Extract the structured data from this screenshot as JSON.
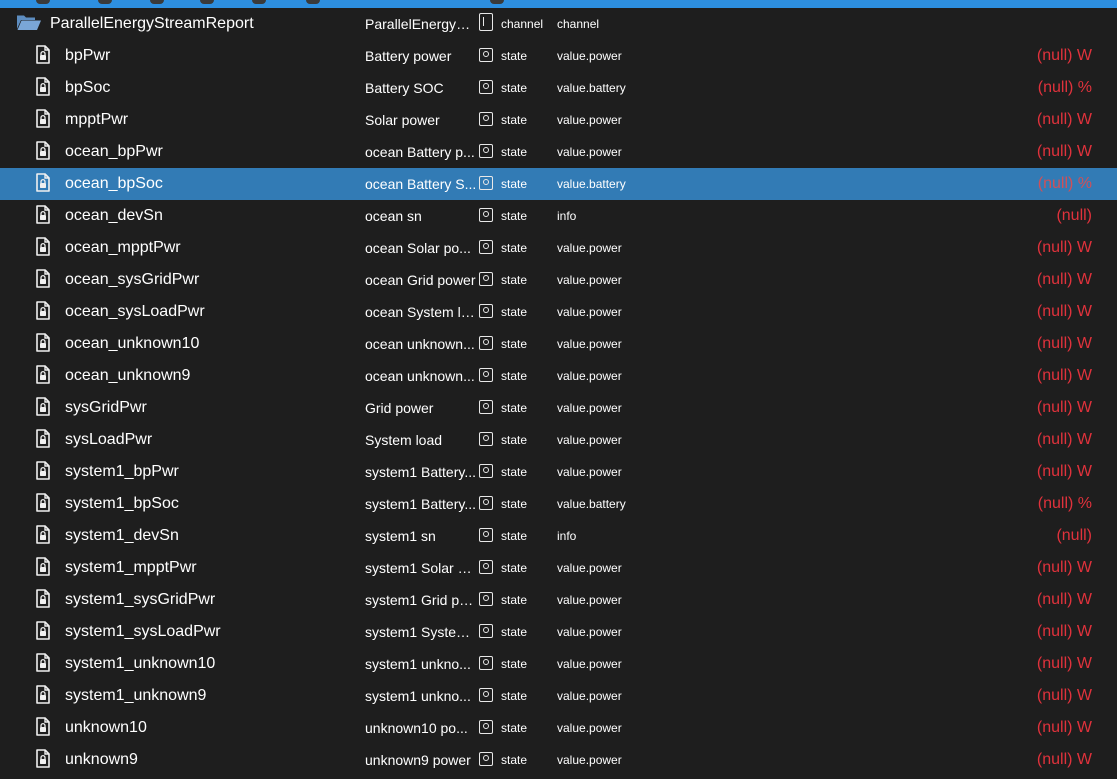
{
  "folder": {
    "name": "ParallelEnergyStreamReport",
    "role_name": "ParallelEnergySt...",
    "type": "channel",
    "role": "channel"
  },
  "rows": [
    {
      "name": "bpPwr",
      "role_name": "Battery power",
      "type": "state",
      "role": "value.power",
      "value": "(null) W"
    },
    {
      "name": "bpSoc",
      "role_name": "Battery SOC",
      "type": "state",
      "role": "value.battery",
      "value": "(null) %"
    },
    {
      "name": "mpptPwr",
      "role_name": "Solar power",
      "type": "state",
      "role": "value.power",
      "value": "(null) W"
    },
    {
      "name": "ocean_bpPwr",
      "role_name": "ocean Battery p...",
      "type": "state",
      "role": "value.power",
      "value": "(null) W"
    },
    {
      "name": "ocean_bpSoc",
      "role_name": "ocean Battery S...",
      "type": "state",
      "role": "value.battery",
      "value": "(null) %",
      "selected": true
    },
    {
      "name": "ocean_devSn",
      "role_name": "ocean sn",
      "type": "state",
      "role": "info",
      "value": "(null)"
    },
    {
      "name": "ocean_mpptPwr",
      "role_name": "ocean Solar po...",
      "type": "state",
      "role": "value.power",
      "value": "(null) W"
    },
    {
      "name": "ocean_sysGridPwr",
      "role_name": "ocean Grid power",
      "type": "state",
      "role": "value.power",
      "value": "(null) W"
    },
    {
      "name": "ocean_sysLoadPwr",
      "role_name": "ocean System lo...",
      "type": "state",
      "role": "value.power",
      "value": "(null) W"
    },
    {
      "name": "ocean_unknown10",
      "role_name": "ocean unknown...",
      "type": "state",
      "role": "value.power",
      "value": "(null) W"
    },
    {
      "name": "ocean_unknown9",
      "role_name": "ocean unknown...",
      "type": "state",
      "role": "value.power",
      "value": "(null) W"
    },
    {
      "name": "sysGridPwr",
      "role_name": "Grid power",
      "type": "state",
      "role": "value.power",
      "value": "(null) W"
    },
    {
      "name": "sysLoadPwr",
      "role_name": "System load",
      "type": "state",
      "role": "value.power",
      "value": "(null) W"
    },
    {
      "name": "system1_bpPwr",
      "role_name": "system1 Battery...",
      "type": "state",
      "role": "value.power",
      "value": "(null) W"
    },
    {
      "name": "system1_bpSoc",
      "role_name": "system1 Battery...",
      "type": "state",
      "role": "value.battery",
      "value": "(null) %"
    },
    {
      "name": "system1_devSn",
      "role_name": "system1 sn",
      "type": "state",
      "role": "info",
      "value": "(null)"
    },
    {
      "name": "system1_mpptPwr",
      "role_name": "system1 Solar p...",
      "type": "state",
      "role": "value.power",
      "value": "(null) W"
    },
    {
      "name": "system1_sysGridPwr",
      "role_name": "system1 Grid po...",
      "type": "state",
      "role": "value.power",
      "value": "(null) W"
    },
    {
      "name": "system1_sysLoadPwr",
      "role_name": "system1 System...",
      "type": "state",
      "role": "value.power",
      "value": "(null) W"
    },
    {
      "name": "system1_unknown10",
      "role_name": "system1 unkno...",
      "type": "state",
      "role": "value.power",
      "value": "(null) W"
    },
    {
      "name": "system1_unknown9",
      "role_name": "system1 unkno...",
      "type": "state",
      "role": "value.power",
      "value": "(null) W"
    },
    {
      "name": "unknown10",
      "role_name": "unknown10 po...",
      "type": "state",
      "role": "value.power",
      "value": "(null) W"
    },
    {
      "name": "unknown9",
      "role_name": "unknown9 power",
      "type": "state",
      "role": "value.power",
      "value": "(null) W"
    }
  ],
  "colors": {
    "background": "#1e1e1e",
    "selected_row": "#327bb5",
    "null_value": "#e0323c",
    "accent_bar": "#2d8fe0"
  },
  "icons": {
    "folder": "folder-open-icon",
    "row": "file-lock-icon",
    "state_type": "state-icon",
    "channel_type": "channel-icon"
  }
}
